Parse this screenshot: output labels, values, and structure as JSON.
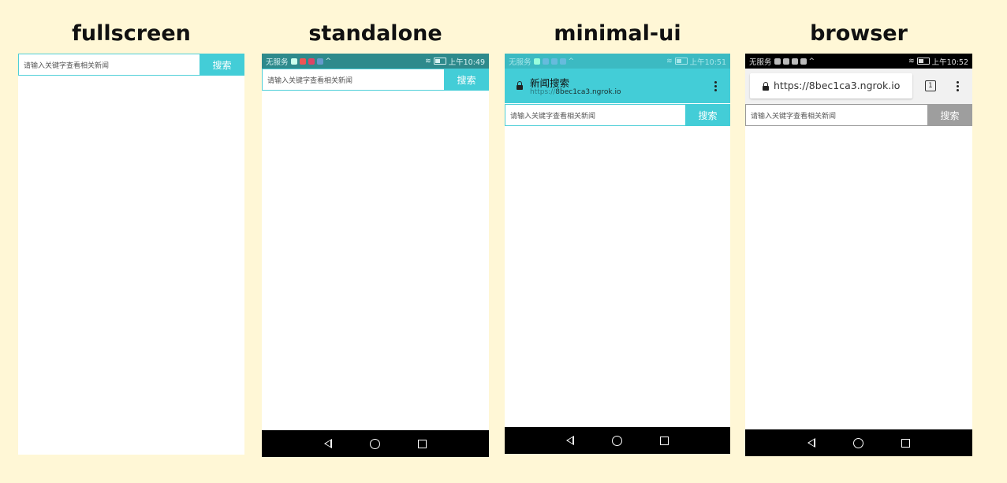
{
  "titles": {
    "fullscreen": "fullscreen",
    "standalone": "standalone",
    "minimal_ui": "minimal-ui",
    "browser": "browser"
  },
  "search": {
    "placeholder": "请输入关键字查看相关新闻",
    "button_label": "搜索"
  },
  "status": {
    "carrier": "无服务",
    "time_standalone": "上午10:49",
    "time_minimal": "上午10:51",
    "time_browser": "上午10:52"
  },
  "minimal_ui": {
    "page_title": "新闻搜索",
    "url_scheme": "https://",
    "url_host": "8bec1ca3.ngrok.io"
  },
  "browser": {
    "url": "https://8bec1ca3.ngrok.io",
    "tab_count": "1"
  },
  "colors": {
    "background": "#fff7d6",
    "accent": "#43cdd7",
    "status_teal": "#2e8a8c",
    "status_black": "#000000",
    "browser_button": "#9e9e9e"
  },
  "icons": {
    "nav_back": "back-triangle-icon",
    "nav_home": "home-circle-icon",
    "nav_recent": "recent-square-icon",
    "lock": "lock-icon",
    "menu": "kebab-menu-icon",
    "tabs": "tab-switcher-icon"
  }
}
